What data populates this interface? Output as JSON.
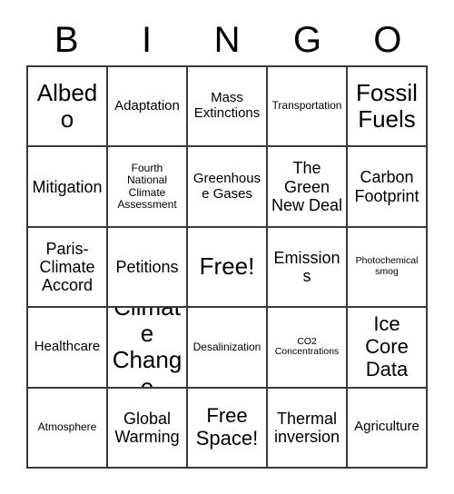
{
  "card": {
    "title_letters": [
      "B",
      "I",
      "N",
      "G",
      "O"
    ],
    "columns": 5,
    "rows": 5,
    "border_color": "#3a3a3a",
    "background_color": "#ffffff",
    "text_color": "#000000",
    "cells": [
      {
        "label": "Albedo",
        "size": "xl",
        "free_space": false
      },
      {
        "label": "Adaptation",
        "size": "sm",
        "free_space": false
      },
      {
        "label": "Mass Extinctions",
        "size": "sm",
        "free_space": false
      },
      {
        "label": "Transportation",
        "size": "xs",
        "free_space": false
      },
      {
        "label": "Fossil Fuels",
        "size": "xl",
        "free_space": false
      },
      {
        "label": "Mitigation",
        "size": "md",
        "free_space": false
      },
      {
        "label": "Fourth National Climate Assessment",
        "size": "xs",
        "free_space": false
      },
      {
        "label": "Greenhouse Gases",
        "size": "sm",
        "free_space": false
      },
      {
        "label": "The Green New Deal",
        "size": "md",
        "free_space": false
      },
      {
        "label": "Carbon Footprint",
        "size": "md",
        "free_space": false
      },
      {
        "label": "Paris-Climate Accord",
        "size": "md",
        "free_space": false
      },
      {
        "label": "Petitions",
        "size": "md",
        "free_space": false
      },
      {
        "label": "Free!",
        "size": "xl",
        "free_space": true
      },
      {
        "label": "Emissions",
        "size": "md",
        "free_space": false
      },
      {
        "label": "Photochemical smog",
        "size": "xxs",
        "free_space": false
      },
      {
        "label": "Healthcare",
        "size": "sm",
        "free_space": false
      },
      {
        "label": "Climate Change",
        "size": "xl",
        "free_space": false
      },
      {
        "label": "Desalinization",
        "size": "xs",
        "free_space": false
      },
      {
        "label": "CO2 Concentrations",
        "size": "xxs",
        "free_space": false
      },
      {
        "label": "Ice Core Data",
        "size": "lg",
        "free_space": false
      },
      {
        "label": "Atmosphere",
        "size": "xs",
        "free_space": false
      },
      {
        "label": "Global Warming",
        "size": "md",
        "free_space": false
      },
      {
        "label": "Free Space!",
        "size": "lg",
        "free_space": true
      },
      {
        "label": "Thermal inversion",
        "size": "md",
        "free_space": false
      },
      {
        "label": "Agriculture",
        "size": "sm",
        "free_space": false
      }
    ]
  }
}
